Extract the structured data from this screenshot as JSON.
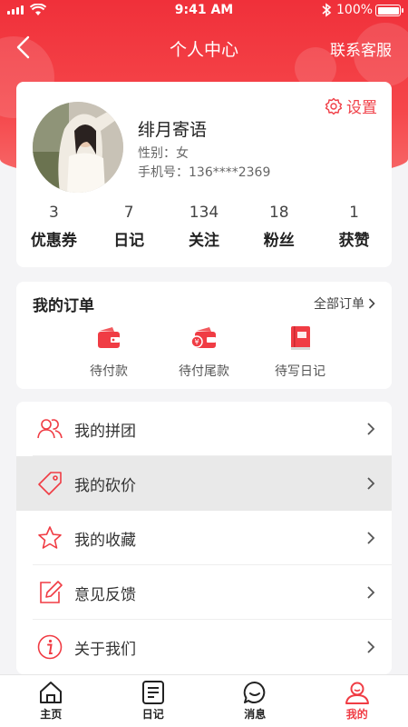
{
  "status_bar": {
    "time": "9:41 AM",
    "battery": "100%"
  },
  "navbar": {
    "title": "个人中心",
    "service_label": "联系客服"
  },
  "profile": {
    "name": "绯月寄语",
    "gender": "性别：女",
    "phone": "手机号：136****2369",
    "settings_label": "设置",
    "stats": [
      {
        "value": "3",
        "label": "优惠券"
      },
      {
        "value": "7",
        "label": "日记"
      },
      {
        "value": "134",
        "label": "关注"
      },
      {
        "value": "18",
        "label": "粉丝"
      },
      {
        "value": "1",
        "label": "获赞"
      }
    ]
  },
  "orders": {
    "title": "我的订单",
    "all_label": "全部订单",
    "items": [
      {
        "label": "待付款",
        "icon": "wallet-icon"
      },
      {
        "label": "待付尾款",
        "icon": "wallet-coin-icon"
      },
      {
        "label": "待写日记",
        "icon": "diary-book-icon"
      }
    ]
  },
  "menu": [
    {
      "label": "我的拼团",
      "icon": "group-users-icon"
    },
    {
      "label": "我的砍价",
      "icon": "price-tag-icon"
    },
    {
      "label": "我的收藏",
      "icon": "star-icon"
    },
    {
      "label": "意见反馈",
      "icon": "edit-icon"
    },
    {
      "label": "关于我们",
      "icon": "info-icon"
    }
  ],
  "tabbar": [
    {
      "label": "主页",
      "icon": "home-icon"
    },
    {
      "label": "日记",
      "icon": "note-icon"
    },
    {
      "label": "消息",
      "icon": "message-icon"
    },
    {
      "label": "我的",
      "icon": "profile-icon"
    }
  ],
  "colors": {
    "accent": "#f03c44",
    "background": "#f4f4f6"
  }
}
